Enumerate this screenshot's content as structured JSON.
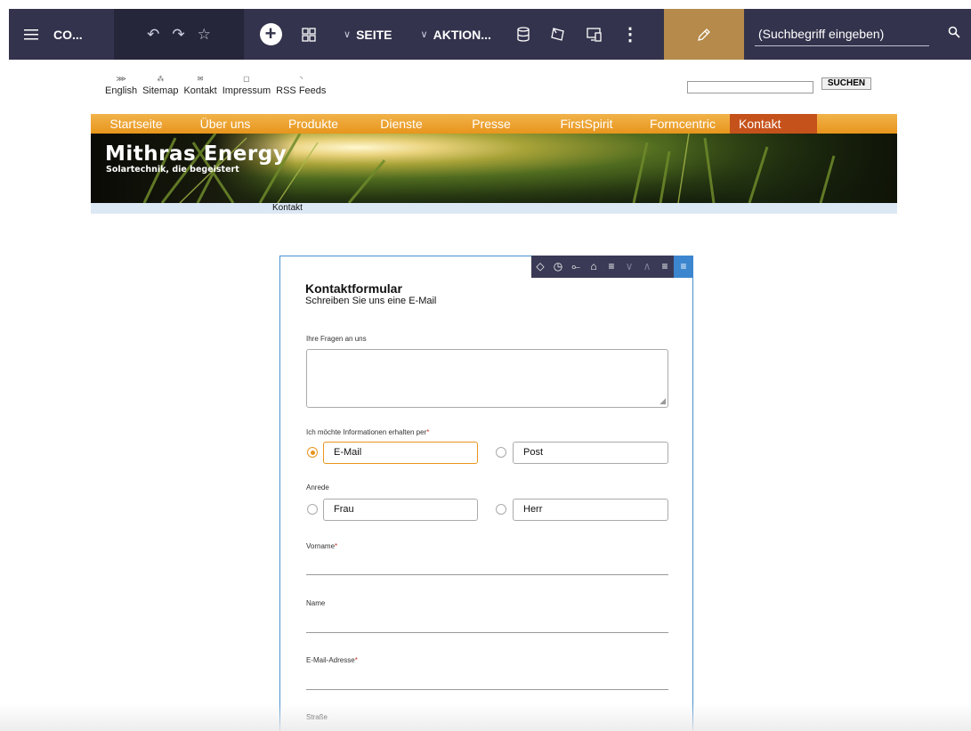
{
  "toolbar": {
    "title": "CO...",
    "page_dropdown": "SEITE",
    "action_dropdown": "AKTION...",
    "search_placeholder": "(Suchbegriff eingeben)",
    "icons": [
      "menu-icon",
      "undo-icon",
      "redo-icon",
      "star-icon",
      "add-icon",
      "grid-icon",
      "database-icon",
      "release-icon",
      "devices-icon",
      "more-icon",
      "pencil-icon",
      "search-icon"
    ],
    "accent_edit": "#b58a4a",
    "bg": "#33334d"
  },
  "meta_links": [
    {
      "label": "English",
      "icon": "language-icon"
    },
    {
      "label": "Sitemap",
      "icon": "sitemap-icon"
    },
    {
      "label": "Kontakt",
      "icon": "mail-icon"
    },
    {
      "label": "Impressum",
      "icon": "document-icon"
    },
    {
      "label": "RSS Feeds",
      "icon": "rss-icon"
    }
  ],
  "site_search": {
    "button": "SUCHEN",
    "value": ""
  },
  "nav": [
    {
      "label": "Startseite",
      "active": false
    },
    {
      "label": "Über uns",
      "active": false
    },
    {
      "label": "Produkte",
      "active": false
    },
    {
      "label": "Dienste",
      "active": false
    },
    {
      "label": "Presse",
      "active": false
    },
    {
      "label": "FirstSpirit",
      "active": false
    },
    {
      "label": "Formcentric",
      "active": false
    },
    {
      "label": "Kontakt",
      "active": true
    }
  ],
  "banner": {
    "brand": "Mithras Energy",
    "tagline": "Solartechnik, die begeistert"
  },
  "breadcrumb": "Kontakt",
  "form": {
    "title": "Kontaktformular",
    "subtitle": "Schreiben Sie uns eine E-Mail",
    "questions_label": "Ihre Fragen an uns",
    "info_label": "Ich möchte Informationen erhalten per",
    "info_options": [
      {
        "label": "E-Mail",
        "selected": true
      },
      {
        "label": "Post",
        "selected": false
      }
    ],
    "salutation_label": "Anrede",
    "salutation_options": [
      {
        "label": "Frau",
        "selected": false
      },
      {
        "label": "Herr",
        "selected": false
      }
    ],
    "firstname_label": "Vorname",
    "name_label": "Name",
    "email_label": "E-Mail-Adresse",
    "street_label": "Straße",
    "required_mark": "*",
    "tool_icons": [
      "move-icon",
      "history-icon",
      "workflow-icon",
      "delete-icon",
      "insert-icon",
      "move-down-icon",
      "move-up-icon",
      "add-section-icon",
      "section-list-icon"
    ]
  }
}
